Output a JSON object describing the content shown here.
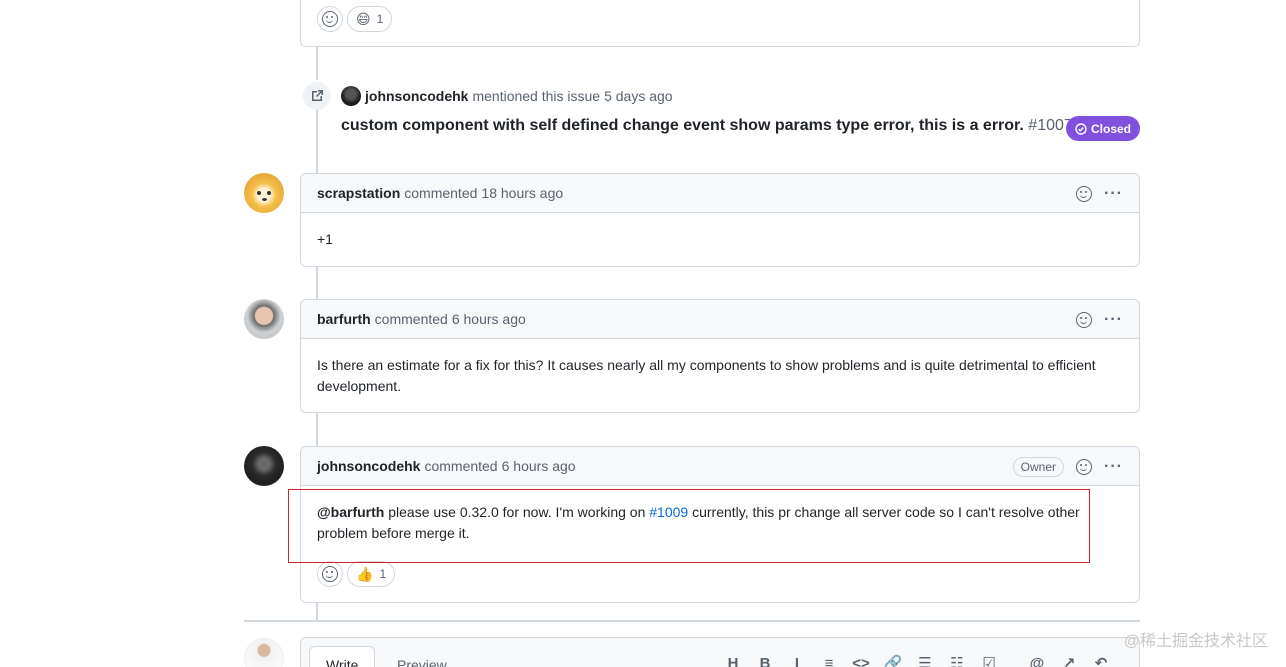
{
  "reactions_top": {
    "count": "1",
    "emoji": "😄"
  },
  "mention_event": {
    "username": "johnsoncodehk",
    "action": "mentioned this issue",
    "time": "5 days ago",
    "issue_title": "custom component with self defined change event show params type error, this is a error.",
    "issue_number": "#1007",
    "status": "Closed"
  },
  "comments": [
    {
      "author": "scrapstation",
      "action": "commented",
      "time": "18 hours ago",
      "body": "+1"
    },
    {
      "author": "barfurth",
      "action": "commented",
      "time": "6 hours ago",
      "body": "Is there an estimate for a fix for this? It causes nearly all my components to show problems and is quite detrimental to efficient development."
    },
    {
      "author": "johnsoncodehk",
      "action": "commented",
      "time": "6 hours ago",
      "badge": "Owner",
      "mention": "@barfurth",
      "body_part1": "please use 0.32.0 for now. I'm working on",
      "link": "#1009",
      "body_part2": "currently, this pr change all server code so I can't resolve other problem before merge it.",
      "reaction_emoji": "👍",
      "reaction_count": "1"
    }
  ],
  "editor": {
    "tab_write": "Write",
    "tab_preview": "Preview",
    "toolbar": [
      "H",
      "B",
      "I",
      "≡",
      "<>",
      "🔗",
      "☰",
      "☷",
      "☑",
      "@",
      "↗",
      "↶"
    ]
  },
  "watermark": "@稀土掘金技术社区",
  "colors": {
    "closed": "#8250df",
    "link": "#0969da",
    "highlight_border": "#d1242f"
  }
}
